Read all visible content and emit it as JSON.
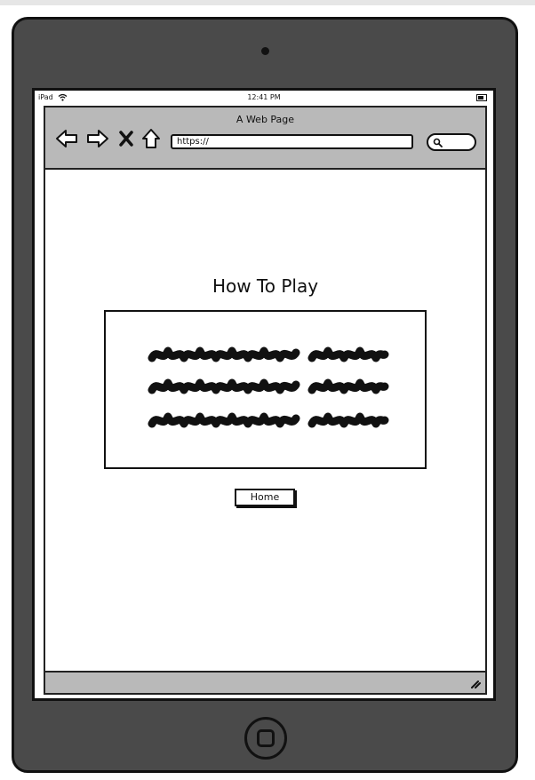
{
  "status_bar": {
    "carrier": "iPad",
    "time": "12:41 PM"
  },
  "browser": {
    "page_title": "A Web Page",
    "url_value": "https://",
    "icons": [
      "back-arrow-icon",
      "forward-arrow-icon",
      "stop-icon",
      "home-icon",
      "search-icon",
      "wifi-icon",
      "battery-icon",
      "resize-grip-icon"
    ]
  },
  "content": {
    "heading": "How To Play",
    "home_button_label": "Home"
  },
  "colors": {
    "device_body": "#4a4a4a",
    "toolbar": "#b9b9b9",
    "outline": "#111111",
    "screen": "#ffffff"
  }
}
